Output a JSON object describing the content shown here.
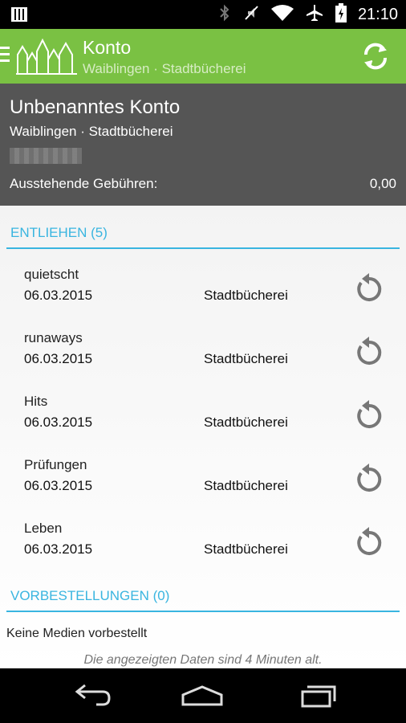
{
  "status_bar": {
    "time": "21:10",
    "icons": [
      "notification-icon",
      "bluetooth-icon",
      "mute-icon",
      "wifi-icon",
      "airplane-icon",
      "battery-icon"
    ]
  },
  "action_bar": {
    "title": "Konto",
    "subtitle": "Waiblingen · Stadtbücherei",
    "color": "#7ac143"
  },
  "account": {
    "name": "Unbenanntes Konto",
    "library": "Waiblingen · Stadtbücherei",
    "fees_label": "Ausstehende Gebühren:",
    "fees_value": "0,00"
  },
  "lent": {
    "header": "ENTLIEHEN (5)",
    "items": [
      {
        "title": "quietscht",
        "date": "06.03.2015",
        "branch": "Stadtbücherei"
      },
      {
        "title": "runaways",
        "date": "06.03.2015",
        "branch": "Stadtbücherei"
      },
      {
        "title": "Hits",
        "date": "06.03.2015",
        "branch": "Stadtbücherei"
      },
      {
        "title": "Prüfungen",
        "date": "06.03.2015",
        "branch": "Stadtbücherei"
      },
      {
        "title": "Leben",
        "date": "06.03.2015",
        "branch": "Stadtbücherei"
      }
    ]
  },
  "reservations": {
    "header": "VORBESTELLUNGEN (0)",
    "empty_text": "Keine Medien vorbestellt"
  },
  "footer": {
    "age_text": "Die angezeigten Daten sind 4 Minuten alt."
  },
  "accent_color": "#39b5e0"
}
